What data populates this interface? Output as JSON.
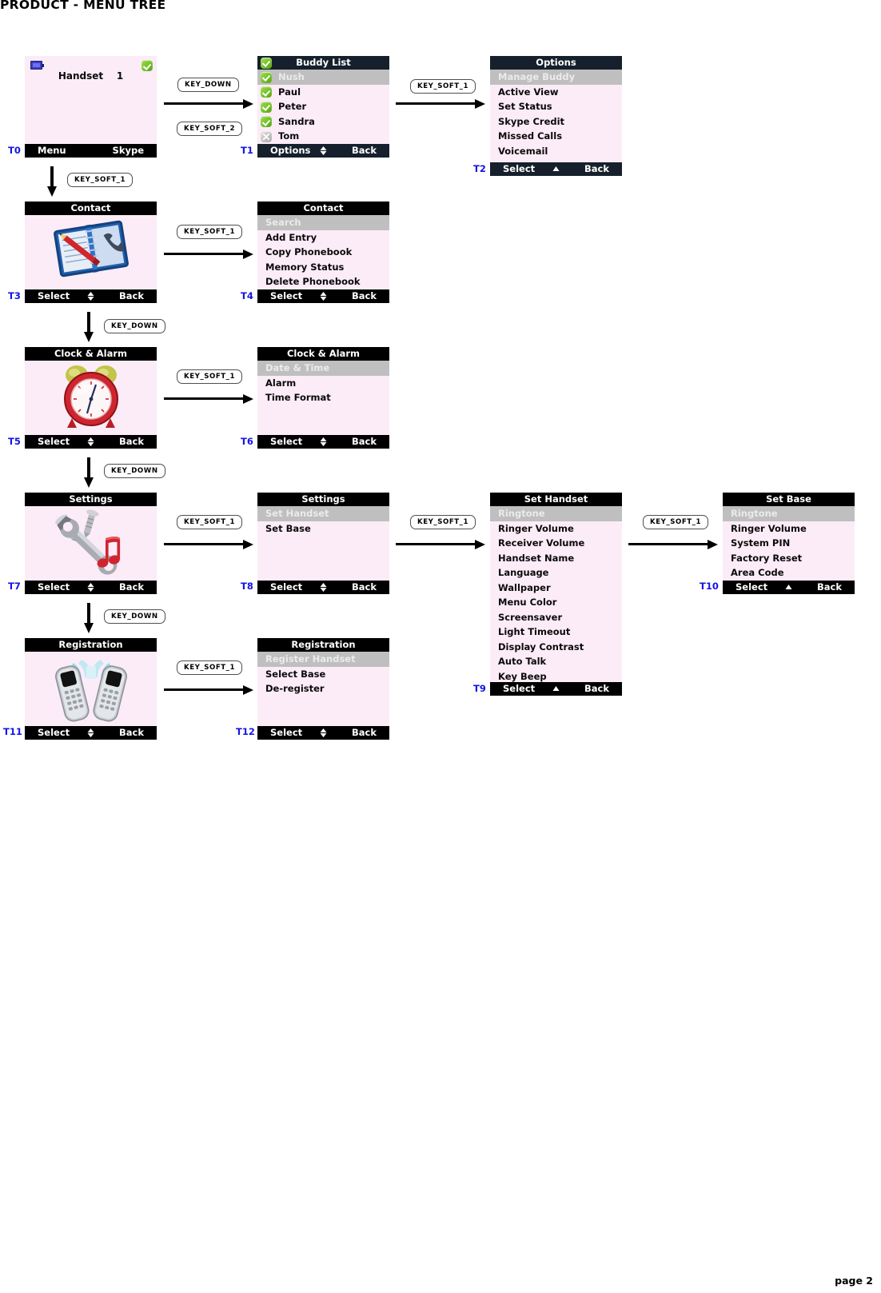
{
  "document": {
    "title": "PRODUCT - MENU TREE",
    "page_label": "page 2"
  },
  "screens": {
    "t0": {
      "id": "T0",
      "kind": "idle",
      "idle_text": "Handset    1",
      "status_icons": [
        "battery-icon",
        "online-check-icon"
      ],
      "footer": {
        "left": "Menu",
        "right": "Skype"
      }
    },
    "t1": {
      "id": "T1",
      "title": "Buddy List",
      "header_icon": "online-check-icon",
      "items": [
        {
          "label": "Nush",
          "icon": "status-online-icon",
          "selected": true
        },
        {
          "label": "Paul",
          "icon": "status-online-icon",
          "selected": false
        },
        {
          "label": "Peter",
          "icon": "status-online-icon",
          "selected": false
        },
        {
          "label": "Sandra",
          "icon": "status-online-icon",
          "selected": false
        },
        {
          "label": "Tom",
          "icon": "status-offline-icon",
          "selected": false
        }
      ],
      "footer": {
        "left": "Options",
        "mid": "updown-arrow-icon",
        "right": "Back"
      }
    },
    "t2": {
      "id": "T2",
      "title": "Options",
      "items": [
        {
          "label": "Manage Buddy",
          "selected": true
        },
        {
          "label": "Active View",
          "selected": false
        },
        {
          "label": "Set Status",
          "selected": false
        },
        {
          "label": "Skype Credit",
          "selected": false
        },
        {
          "label": "Missed Calls",
          "selected": false
        },
        {
          "label": "Voicemail",
          "selected": false
        }
      ],
      "footer": {
        "left": "Select",
        "mid": "updown-arrow-icon",
        "right": "Back"
      }
    },
    "t3": {
      "id": "T3",
      "title": "Contact",
      "art": "phonebook-icon",
      "footer": {
        "left": "Select",
        "mid": "updown-arrow-icon",
        "right": "Back"
      }
    },
    "t4": {
      "id": "T4",
      "title": "Contact",
      "items": [
        {
          "label": "Search",
          "selected": true
        },
        {
          "label": "Add Entry",
          "selected": false
        },
        {
          "label": "Copy Phonebook",
          "selected": false
        },
        {
          "label": "Memory Status",
          "selected": false
        },
        {
          "label": "Delete Phonebook",
          "selected": false
        }
      ],
      "footer": {
        "left": "Select",
        "mid": "updown-arrow-icon",
        "right": "Back"
      }
    },
    "t5": {
      "id": "T5",
      "title": "Clock & Alarm",
      "art": "alarm-clock-icon",
      "footer": {
        "left": "Select",
        "mid": "updown-arrow-icon",
        "right": "Back"
      }
    },
    "t6": {
      "id": "T6",
      "title": "Clock & Alarm",
      "items": [
        {
          "label": "Date & Time",
          "selected": true
        },
        {
          "label": "Alarm",
          "selected": false
        },
        {
          "label": "Time Format",
          "selected": false
        }
      ],
      "footer": {
        "left": "Select",
        "mid": "updown-arrow-icon",
        "right": "Back"
      }
    },
    "t7": {
      "id": "T7",
      "title": "Settings",
      "art": "wrench-music-icon",
      "footer": {
        "left": "Select",
        "mid": "updown-arrow-icon",
        "right": "Back"
      }
    },
    "t8": {
      "id": "T8",
      "title": "Settings",
      "items": [
        {
          "label": "Set Handset",
          "selected": true
        },
        {
          "label": "Set Base",
          "selected": false
        }
      ],
      "footer": {
        "left": "Select",
        "mid": "updown-arrow-icon",
        "right": "Back"
      }
    },
    "t9": {
      "id": "T9",
      "title": "Set Handset",
      "items": [
        {
          "label": "Ringtone",
          "selected": true
        },
        {
          "label": "Ringer Volume",
          "selected": false
        },
        {
          "label": "Receiver Volume",
          "selected": false
        },
        {
          "label": "Handset Name",
          "selected": false
        },
        {
          "label": "Language",
          "selected": false
        },
        {
          "label": "Wallpaper",
          "selected": false
        },
        {
          "label": "Menu Color",
          "selected": false
        },
        {
          "label": "Screensaver",
          "selected": false
        },
        {
          "label": "Light Timeout",
          "selected": false
        },
        {
          "label": "Display Contrast",
          "selected": false
        },
        {
          "label": "Auto Talk",
          "selected": false
        },
        {
          "label": "Key Beep",
          "selected": false
        }
      ],
      "footer": {
        "left": "Select",
        "mid": "updown-arrow-icon",
        "right": "Back"
      }
    },
    "t10": {
      "id": "T10",
      "title": "Set Base",
      "items": [
        {
          "label": "Ringtone",
          "selected": true
        },
        {
          "label": "Ringer Volume",
          "selected": false
        },
        {
          "label": "System PIN",
          "selected": false
        },
        {
          "label": "Factory Reset",
          "selected": false
        },
        {
          "label": "Area Code",
          "selected": false
        }
      ],
      "footer": {
        "left": "Select",
        "mid": "updown-arrow-icon",
        "right": "Back"
      }
    },
    "t11": {
      "id": "T11",
      "title": "Registration",
      "art": "two-handsets-icon",
      "footer": {
        "left": "Select",
        "mid": "updown-arrow-icon",
        "right": "Back"
      }
    },
    "t12": {
      "id": "T12",
      "title": "Registration",
      "items": [
        {
          "label": "Register Handset",
          "selected": true
        },
        {
          "label": "Select Base",
          "selected": false
        },
        {
          "label": "De-register",
          "selected": false
        }
      ],
      "footer": {
        "left": "Select",
        "mid": "updown-arrow-icon",
        "right": "Back"
      }
    }
  },
  "keys": {
    "k_t0_t1_down": "KEY_DOWN",
    "k_t0_t1_soft2": "KEY_SOFT_2",
    "k_t1_t2": "KEY_SOFT_1",
    "k_t0_t3": "KEY_SOFT_1",
    "k_t3_t4": "KEY_SOFT_1",
    "k_t3_t5": "KEY_DOWN",
    "k_t5_t6": "KEY_SOFT_1",
    "k_t5_t7": "KEY_DOWN",
    "k_t7_t8": "KEY_SOFT_1",
    "k_t8_t9": "KEY_SOFT_1",
    "k_t9_t10": "KEY_SOFT_1",
    "k_t7_t11": "KEY_DOWN",
    "k_t11_t12": "KEY_SOFT_1"
  },
  "colors": {
    "screen_bg": "#fcecf7",
    "header_black": "#000000",
    "header_navy": "#16202c",
    "selected_row": "#bfbfbf",
    "tlabel_blue": "#1414e6",
    "online_green": "#74c327"
  }
}
